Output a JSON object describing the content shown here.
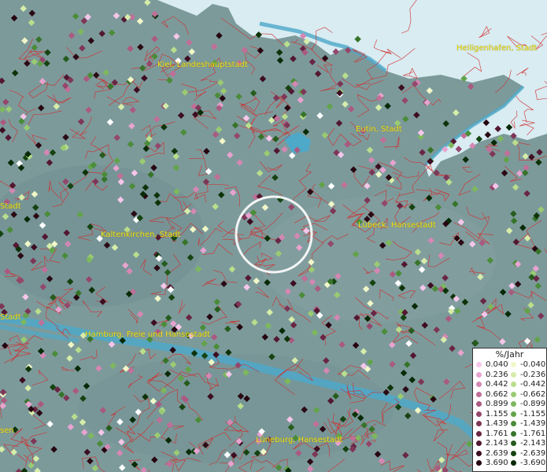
{
  "cities": [
    {
      "name": "Kiel, Landeshauptstadt"
    },
    {
      "name": "Heiligenhafen, Stadt"
    },
    {
      "name": "Eutin, Stadt"
    },
    {
      "name": "Kaltenkirchen, Stadt"
    },
    {
      "name": "Lübeck, Hansestadt"
    },
    {
      "name": "Hamburg, Freie und Hansestadt"
    },
    {
      "name": "Lüneburg, Hansestadt"
    },
    {
      "name": "Stadt"
    },
    {
      "name": "Stadt"
    },
    {
      "name": "sen"
    }
  ],
  "legend": {
    "title": "%/Jahr",
    "positive": [
      {
        "label": "0.040",
        "color": "#f5c6ea"
      },
      {
        "label": "0.236",
        "color": "#e8a3cf"
      },
      {
        "label": "0.442",
        "color": "#d487b3"
      },
      {
        "label": "0.662",
        "color": "#c06f98"
      },
      {
        "label": "0.899",
        "color": "#aa5a80"
      },
      {
        "label": "1.155",
        "color": "#94476b"
      },
      {
        "label": "1.439",
        "color": "#7e3656"
      },
      {
        "label": "1.761",
        "color": "#692643"
      },
      {
        "label": "2.143",
        "color": "#531831"
      },
      {
        "label": "2.639",
        "color": "#3d0d21"
      },
      {
        "label": "3.690",
        "color": "#260511"
      }
    ],
    "negative": [
      {
        "label": "-0.040",
        "color": "#f0f7c8"
      },
      {
        "label": "-0.236",
        "color": "#d6edaa"
      },
      {
        "label": "-0.442",
        "color": "#b9de8c"
      },
      {
        "label": "-0.662",
        "color": "#9acb72"
      },
      {
        "label": "-0.899",
        "color": "#7db85d"
      },
      {
        "label": "-1.155",
        "color": "#62a34a"
      },
      {
        "label": "-1.439",
        "color": "#4b8c39"
      },
      {
        "label": "-1.761",
        "color": "#37742a"
      },
      {
        "label": "-2.143",
        "color": "#255c1d"
      },
      {
        "label": "-2.639",
        "color": "#154311"
      },
      {
        "label": "-3.690",
        "color": "#082a07"
      }
    ]
  },
  "colors": {
    "land": "#7d9a9b",
    "sea": "#d8ecf2",
    "river": "#4ea8c8",
    "borders": "#d42a2a",
    "labels": "#f2e21a",
    "highlight_circle": "#ffffff"
  }
}
